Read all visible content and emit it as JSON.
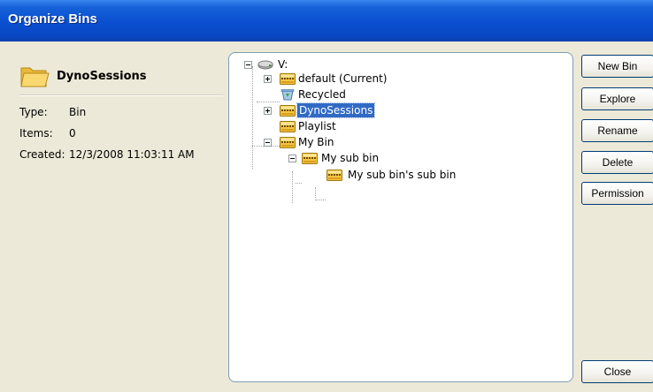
{
  "window": {
    "title": "Organize Bins"
  },
  "details": {
    "name": "DynoSessions",
    "folder_icon": "folder-icon",
    "properties": [
      {
        "key": "Type:",
        "value": "Bin"
      },
      {
        "key": "Items:",
        "value": "0"
      },
      {
        "key": "Created:",
        "value": "12/3/2008 11:03:11 AM"
      }
    ]
  },
  "tree": {
    "root": "V:",
    "root_icon": "drive-icon",
    "nodes": [
      {
        "label": "default (Current)",
        "icon": "bin-icon"
      },
      {
        "label": "Recycled",
        "icon": "recycle-icon"
      },
      {
        "label": "DynoSessions",
        "icon": "bin-icon",
        "selected": true
      },
      {
        "label": "Playlist",
        "icon": "bin-icon"
      },
      {
        "label": "My Bin",
        "icon": "bin-icon"
      },
      {
        "label": "My sub bin",
        "icon": "bin-icon"
      },
      {
        "label": "My sub bin's sub bin",
        "icon": "bin-icon"
      }
    ]
  },
  "buttons": {
    "new_bin": "New Bin",
    "explore": "Explore",
    "rename": "Rename",
    "delete": "Delete",
    "permission": "Permission",
    "close": "Close"
  },
  "colors": {
    "title_bar": "#0A4FD0",
    "selection": "#316AC5",
    "dialog_bg": "#ECE9D8"
  }
}
